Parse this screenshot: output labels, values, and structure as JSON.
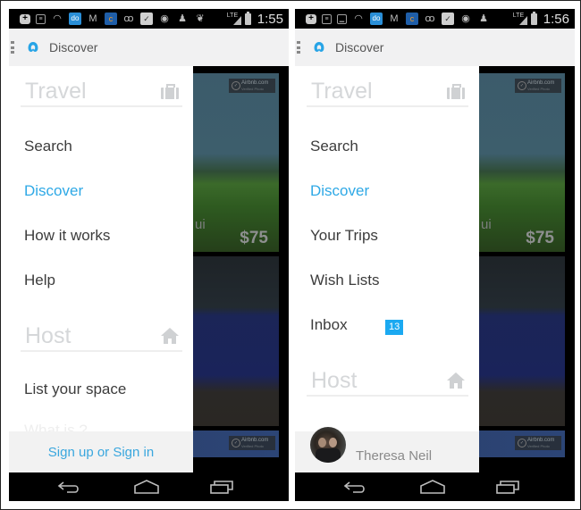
{
  "screens": [
    {
      "status_bar": {
        "notification_icons": [
          "plus-icon",
          "document-icon",
          "wifi-lock-icon",
          "app-do-icon",
          "gmail-icon",
          "app-c-icon",
          "voicemail-icon",
          "checkbox-icon",
          "circle-target-icon",
          "ghost-icon",
          "twitter-icon"
        ],
        "network": "LTE",
        "time": "1:55"
      },
      "app_bar": {
        "title": "Discover",
        "logo": "airbnb-logo"
      },
      "drawer": {
        "sections": [
          {
            "title": "Travel",
            "icon": "briefcase-icon",
            "items": [
              {
                "label": "Search",
                "active": false
              },
              {
                "label": "Discover",
                "active": true
              },
              {
                "label": "How it works",
                "active": false
              },
              {
                "label": "Help",
                "active": false
              }
            ]
          },
          {
            "title": "Host",
            "icon": "house-icon",
            "items": [
              {
                "label": "List your space",
                "active": false
              },
              {
                "label": "What is ?",
                "active": false
              }
            ]
          }
        ],
        "footer": {
          "type": "sign-in",
          "label": "Sign up or Sign in"
        }
      },
      "background": {
        "listing": {
          "location_fragment": "ui",
          "price": "$75"
        },
        "badge": {
          "title": "Airbnb.com",
          "subtitle": "Verified Photo"
        }
      },
      "nav_bar": [
        "back-icon",
        "home-icon",
        "recent-apps-icon"
      ]
    },
    {
      "status_bar": {
        "notification_icons": [
          "plus-icon",
          "document-icon",
          "image-icon",
          "wifi-lock-icon",
          "app-do-icon",
          "gmail-icon",
          "app-c-icon",
          "voicemail-icon",
          "checkbox-icon",
          "circle-target-icon",
          "ghost-icon"
        ],
        "network": "LTE",
        "time": "1:56"
      },
      "app_bar": {
        "title": "Discover",
        "logo": "airbnb-logo"
      },
      "drawer": {
        "sections": [
          {
            "title": "Travel",
            "icon": "briefcase-icon",
            "items": [
              {
                "label": "Search",
                "active": false
              },
              {
                "label": "Discover",
                "active": true
              },
              {
                "label": "Your Trips",
                "active": false
              },
              {
                "label": "Wish Lists",
                "active": false
              },
              {
                "label": "Inbox",
                "active": false,
                "badge": "13"
              }
            ]
          },
          {
            "title": "Host",
            "icon": "house-icon",
            "items": []
          }
        ],
        "footer": {
          "type": "profile",
          "user_name": "Theresa Neil"
        }
      },
      "background": {
        "listing": {
          "location_fragment": "ui",
          "price": "$75"
        },
        "badge": {
          "title": "Airbnb.com",
          "subtitle": "Verified Photo"
        }
      },
      "nav_bar": [
        "back-icon",
        "home-icon",
        "recent-apps-icon"
      ]
    }
  ],
  "colors": {
    "accent": "#2fa9e6",
    "badge_bg": "#1ba9f1",
    "section_title": "#d5d7d9",
    "menu_text": "#3c3c3c",
    "app_bar_bg": "#f1f1f2",
    "footer_bg": "#f2f2f2"
  }
}
